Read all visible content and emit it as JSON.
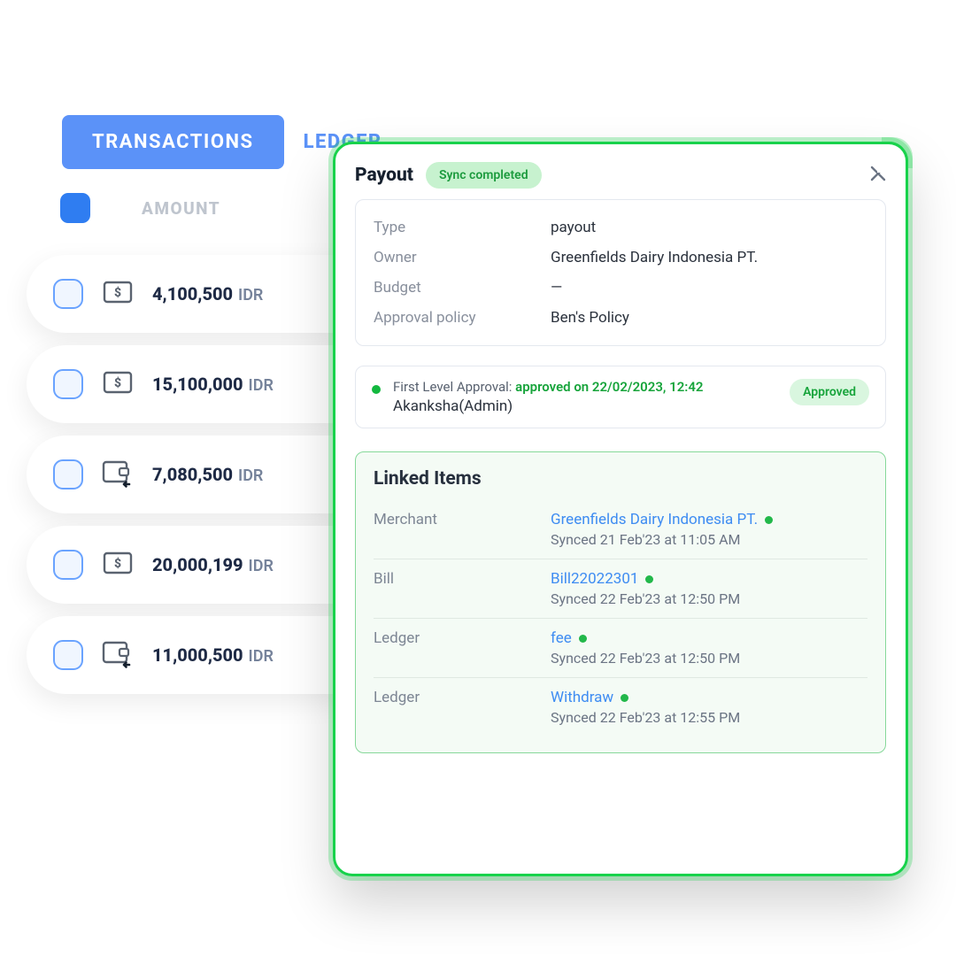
{
  "tabs": {
    "transactions": "TRANSACTIONS",
    "ledger": "LEDGER"
  },
  "header": {
    "amount": "AMOUNT"
  },
  "rows": [
    {
      "amount": "4,100,500",
      "currency": "IDR",
      "icon": "cash"
    },
    {
      "amount": "15,100,000",
      "currency": "IDR",
      "icon": "cash"
    },
    {
      "amount": "7,080,500",
      "currency": "IDR",
      "icon": "wallet-in"
    },
    {
      "amount": "20,000,199",
      "currency": "IDR",
      "icon": "cash"
    },
    {
      "amount": "11,000,500",
      "currency": "IDR",
      "icon": "wallet-in"
    }
  ],
  "panel": {
    "title": "Payout",
    "chip": "Sync completed",
    "info": {
      "type_label": "Type",
      "type_value": "payout",
      "owner_label": "Owner",
      "owner_value": "Greenfields Dairy Indonesia PT.",
      "budget_label": "Budget",
      "budget_value": "—",
      "policy_label": "Approval policy",
      "policy_value": "Ben's Policy"
    },
    "approval": {
      "prefix": "First Level Approval: ",
      "status_text": "approved on 22/02/2023, 12:42",
      "user": "Akanksha(Admin)",
      "badge": "Approved"
    },
    "linked": {
      "title": "Linked Items",
      "items": [
        {
          "label": "Merchant",
          "link": "Greenfields Dairy Indonesia PT.",
          "sync": "Synced  21 Feb'23 at 11:05 AM"
        },
        {
          "label": "Bill",
          "link": "Bill22022301",
          "sync": "Synced  22 Feb'23 at 12:50 PM"
        },
        {
          "label": "Ledger",
          "link": "fee",
          "sync": "Synced  22 Feb'23 at 12:50 PM"
        },
        {
          "label": "Ledger",
          "link": "Withdraw",
          "sync": "Synced  22 Feb'23 at 12:55 PM"
        }
      ]
    }
  }
}
